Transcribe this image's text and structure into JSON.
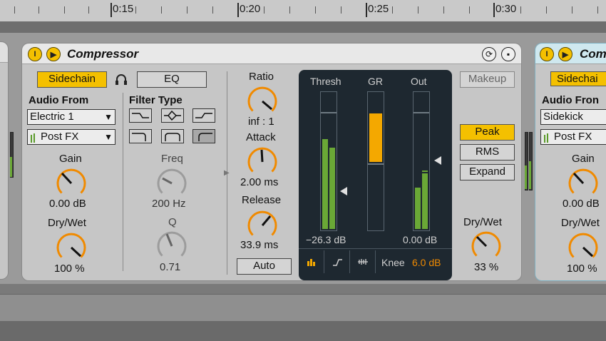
{
  "ruler": {
    "ticks": [
      "0:15",
      "0:20",
      "0:25",
      "0:30"
    ]
  },
  "compressor": {
    "title": "Compressor",
    "sidechain_label": "Sidechain",
    "eq_label": "EQ",
    "audio_from_label": "Audio From",
    "audio_from_value": "Electric 1",
    "post_fx_value": "Post FX",
    "gain_label": "Gain",
    "gain_value": "0.00 dB",
    "drywet_left_label": "Dry/Wet",
    "drywet_left_value": "100 %",
    "filter_type_label": "Filter Type",
    "freq_label": "Freq",
    "freq_value": "200 Hz",
    "q_label": "Q",
    "q_value": "0.71",
    "ratio_label": "Ratio",
    "ratio_value": "inf : 1",
    "attack_label": "Attack",
    "attack_value": "2.00 ms",
    "release_label": "Release",
    "release_value": "33.9 ms",
    "auto_label": "Auto",
    "display": {
      "thresh_label": "Thresh",
      "gr_label": "GR",
      "out_label": "Out",
      "thresh_value": "−26.3 dB",
      "out_value": "0.00 dB",
      "knee_label": "Knee",
      "knee_value": "6.0 dB"
    },
    "makeup_label": "Makeup",
    "peak_label": "Peak",
    "rms_label": "RMS",
    "expand_label": "Expand",
    "drywet_right_label": "Dry/Wet",
    "drywet_right_value": "33 %"
  },
  "next_device": {
    "title_partial": "Com",
    "sidechain_partial": "Sidechai",
    "audio_from_partial": "Audio Fron",
    "audio_from_value": "Sidekick",
    "post_fx_value": "Post FX",
    "gain_label": "Gain",
    "gain_value": "0.00 dB",
    "drywet_label": "Dry/Wet",
    "drywet_value": "100 %"
  },
  "colors": {
    "accent": "#f4c000",
    "knob_arc": "#f08a00",
    "meter_green": "#6aa836",
    "gr_orange": "#f4a800",
    "knee_orange": "#f08a00"
  }
}
